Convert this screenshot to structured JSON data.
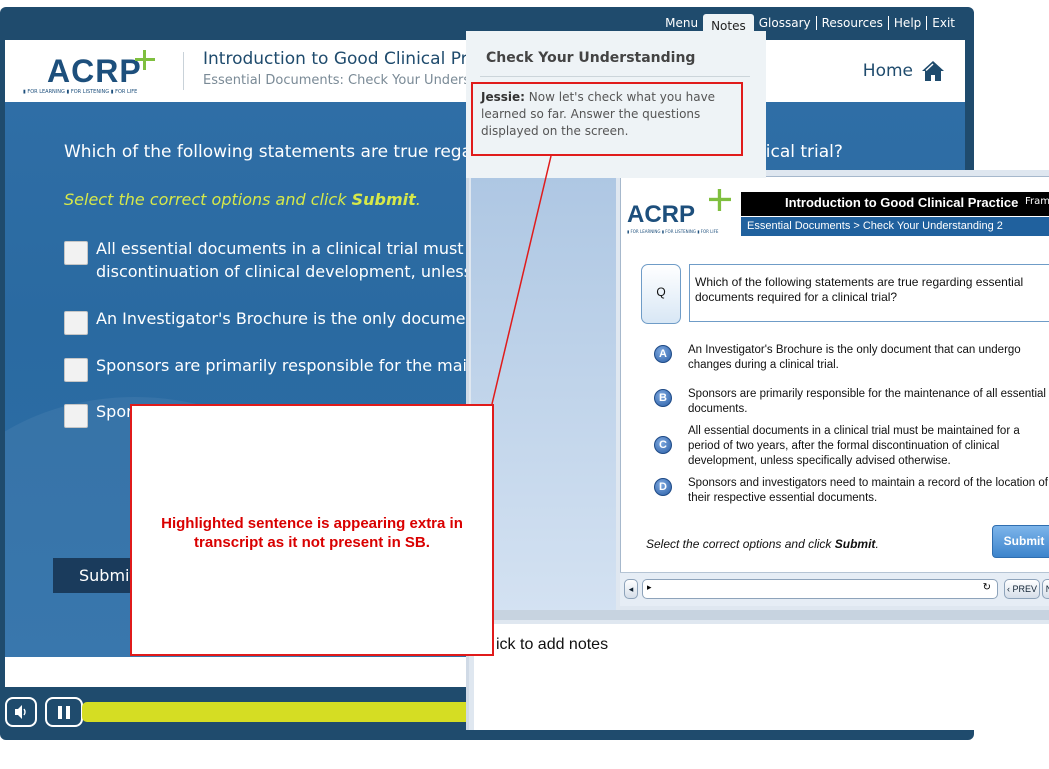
{
  "topmenu": {
    "menu": "Menu",
    "notes": "Notes",
    "glossary": "Glossary",
    "resources": "Resources",
    "help": "Help",
    "exit": "Exit"
  },
  "header": {
    "logo_text": "ACRP",
    "logo_tagline": "▮ FOR LEARNING ▮ FOR LISTENING ▮ FOR LIFE",
    "title": "Introduction to Good Clinical Pract",
    "subtitle": "Essential Documents: Check Your Unders",
    "home": "Home"
  },
  "slide": {
    "question_left": "Which of the following statements are true regarding",
    "question_right": "nical trial?",
    "instruction_pre": "Select the correct options and click ",
    "instruction_bold": "Submit",
    "instruction_post": ".",
    "options": [
      {
        "line1": "All essential documents in a clinical trial must be",
        "line2": "discontinuation of clinical development, unless s"
      },
      {
        "line1": "An Investigator's Brochure is the only document"
      },
      {
        "line1": "Sponsors are primarily responsible for the maint"
      },
      {
        "line1": "Spor"
      }
    ],
    "submit": "Submit"
  },
  "notes_panel": {
    "heading": "Check Your Understanding",
    "speaker": "Jessie:",
    "text": "Now let's check what you have learned so far. Answer the questions displayed on the screen."
  },
  "storyboard": {
    "title": "Introduction to Good Clinical Practice",
    "frame_label": "Frame",
    "breadcrumb": "Essential Documents > Check Your Understanding 2",
    "logo_text": "ACRP",
    "logo_tagline": "▮ FOR LEARNING ▮ FOR LISTENING ▮ FOR LIFE",
    "q_label": "Q",
    "question": "Which of the following statements are true regarding essential documents required for a clinical trial?",
    "answers": [
      {
        "letter": "A",
        "text": "An Investigator's Brochure is the only document that can undergo changes during a clinical trial."
      },
      {
        "letter": "B",
        "text": "Sponsors are primarily responsible for the maintenance of all essential documents."
      },
      {
        "letter": "C",
        "text": "All essential documents in a clinical trial must be maintained for a period of two years, after the formal discontinuation of clinical development, unless specifically advised otherwise."
      },
      {
        "letter": "D",
        "text": "Sponsors and investigators need to maintain a record of the location of their respective essential documents."
      }
    ],
    "instruction_pre": "Select the correct options and click ",
    "instruction_bold": "Submit",
    "instruction_post": ".",
    "submit": "Submit",
    "prev": "‹ PREV",
    "next": "N",
    "notes_placeholder": "ick to add notes"
  },
  "callout": {
    "text": "Highlighted sentence is appearing extra in transcript as it not present in SB."
  },
  "colors": {
    "frame": "#1f4b6d",
    "stage": "#2d6fa8",
    "accent_yellow": "#d5dd23",
    "callout_red": "#e01b1b"
  }
}
